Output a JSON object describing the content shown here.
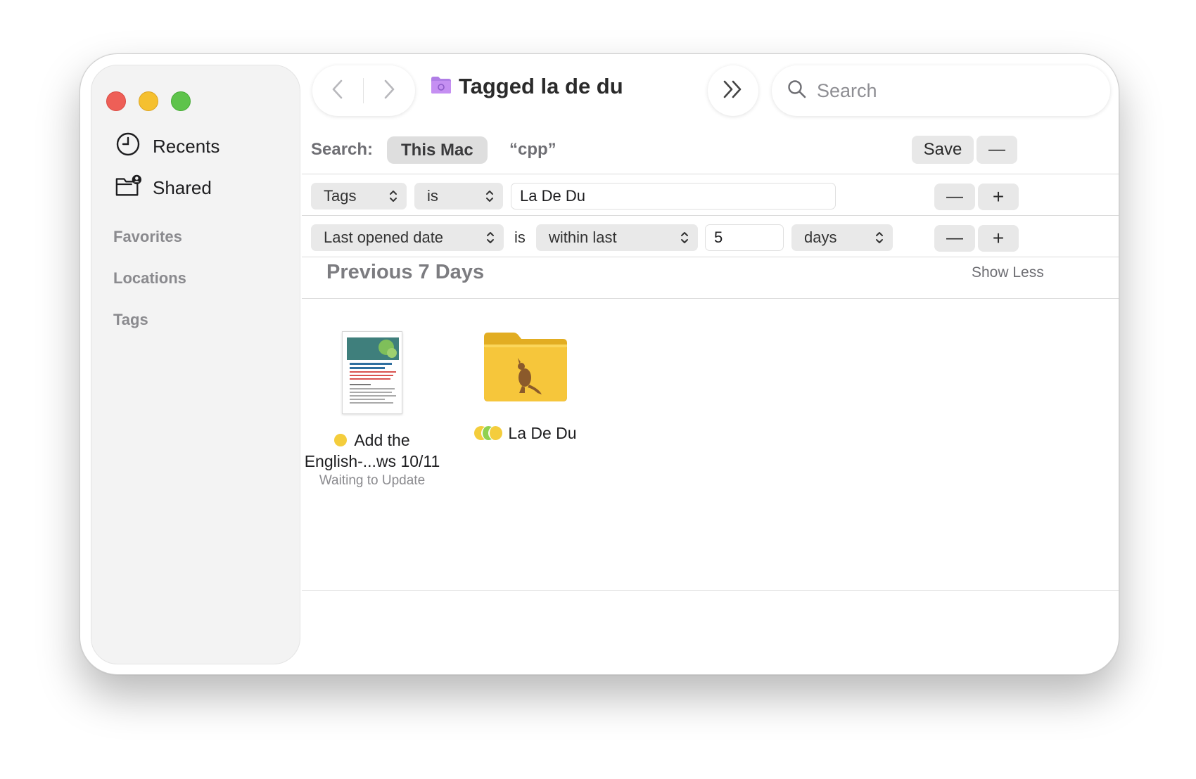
{
  "window": {
    "title": "Tagged la de du",
    "folder_icon": "smart-folder-icon"
  },
  "sidebar": {
    "items": [
      {
        "label": "Recents",
        "icon": "clock-icon"
      },
      {
        "label": "Shared",
        "icon": "shared-folder-icon"
      }
    ],
    "sections": [
      "Favorites",
      "Locations",
      "Tags"
    ]
  },
  "toolbar": {
    "search_placeholder": "Search"
  },
  "scope": {
    "label": "Search:",
    "this_mac": "This Mac",
    "query": "“cpp”",
    "save_label": "Save",
    "minus_label": "—"
  },
  "criteria": [
    {
      "attribute": "Tags",
      "operator": "is",
      "value": "La De Du"
    },
    {
      "attribute": "Last opened date",
      "operator": "is",
      "range": "within last",
      "value": "5",
      "unit": "days"
    }
  ],
  "buttons": {
    "minus": "—",
    "plus": "+"
  },
  "results": {
    "group_title": "Previous 7 Days",
    "show_less": "Show Less",
    "items": [
      {
        "name_line1": "Add the",
        "name_line2": "English-...ws 10/11",
        "status": "Waiting to Update",
        "tag_color": "#f4cd3c",
        "icon": "document-thumbnail-icon"
      },
      {
        "name_line1": "La De Du",
        "tag_colors": [
          "#f4cd3c",
          "#8fd14f",
          "#f4cd3c"
        ],
        "icon": "kangaroo-folder-icon"
      }
    ]
  },
  "colors": {
    "close": "#ee5f57",
    "minimize": "#f5c02f",
    "zoom": "#5ec34b",
    "folder": "#f6c63b"
  }
}
